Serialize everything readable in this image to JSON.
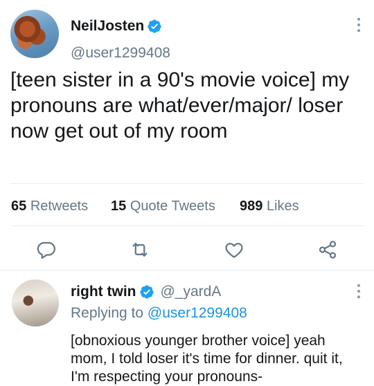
{
  "tweet": {
    "author_name": "NeilJosten",
    "author_handle": "@user1299408",
    "text": "[teen sister in a 90's movie voice] my pronouns are what/ever/major/ loser now get out of my room",
    "stats": {
      "retweets_count": "65",
      "retweets_label": "Retweets",
      "quote_count": "15",
      "quote_label": "Quote Tweets",
      "likes_count": "989",
      "likes_label": "Likes"
    }
  },
  "reply": {
    "author_name": "right twin",
    "author_handle": "@_yardA",
    "replying_prefix": "Replying to",
    "replying_to": "@user1299408",
    "text": "[obnoxious younger brother voice] yeah mom, I told loser it's time for dinner. quit it, I'm respecting your pronouns-"
  },
  "colors": {
    "verified": "#1da1f2",
    "link": "#1b95e0",
    "muted": "#657786",
    "icon": "#657786"
  }
}
